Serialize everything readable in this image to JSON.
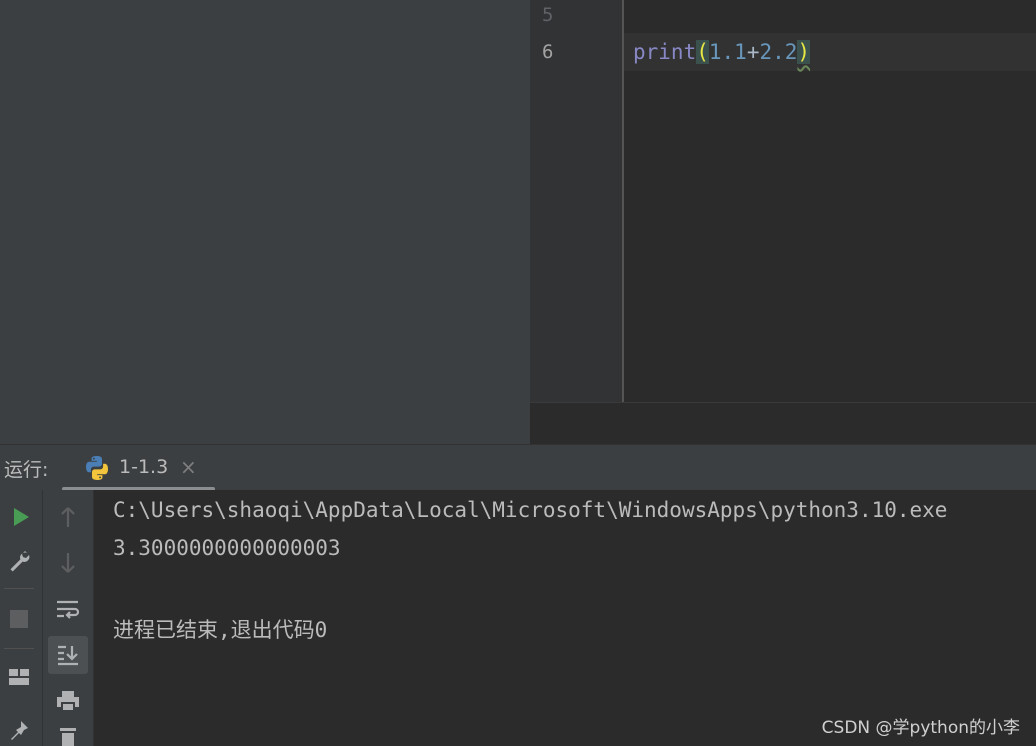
{
  "editor": {
    "line_numbers": [
      "5",
      "6"
    ],
    "code": {
      "func": "print",
      "open_paren": "(",
      "num1": "1.1",
      "op": "+",
      "num2": "2.2",
      "close_paren": ")"
    }
  },
  "run_panel": {
    "label": "运行:",
    "tab_title": "1-1.3",
    "tab_close": "×"
  },
  "console": {
    "lines": [
      "C:\\Users\\shaoqi\\AppData\\Local\\Microsoft\\WindowsApps\\python3.10.exe",
      "3.3000000000000003",
      "进程已结束,退出代码0"
    ]
  },
  "watermark": "CSDN @学python的小李",
  "icons": {
    "toolbar1": [
      "run-icon",
      "wrench-icon",
      "stop-icon",
      "layout-icon",
      "pin-icon"
    ],
    "toolbar2": [
      "up-arrow-icon",
      "down-arrow-icon",
      "soft-wrap-icon",
      "scroll-to-end-icon",
      "print-icon",
      "trash-icon"
    ]
  },
  "colors": {
    "run_green": "#499c54",
    "keyword_func": "#8888c6",
    "number": "#6897bb",
    "paren_highlight": "#e8e845"
  }
}
